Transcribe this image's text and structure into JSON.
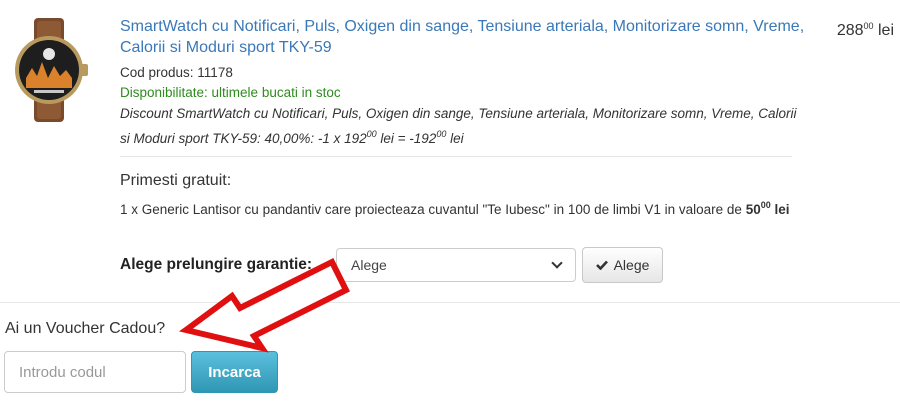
{
  "product": {
    "title": "SmartWatch cu Notificari, Puls, Oxigen din sange, Tensiune arteriala, Monitorizare somn, Vreme, Calorii si Moduri sport TKY-59",
    "price_int": "288",
    "price_dec": "00",
    "currency": "lei",
    "code": "Cod produs: 11178",
    "availability": "Disponibilitate: ultimele bucati in stoc",
    "discount_text": "Discount SmartWatch cu Notificari, Puls, Oxigen din sange, Tensiune arteriala, Monitorizare somn, Vreme, Calorii si Moduri sport TKY-59: 40,00%: -1 x 192",
    "discount_dec1": "00",
    "discount_mid": " lei = -192",
    "discount_dec2": "00",
    "discount_end": " lei"
  },
  "gift": {
    "heading": "Primesti gratuit:",
    "description": "1 x Generic Lantisor cu pandantiv care proiecteaza cuvantul \"Te Iubesc\" in 100 de limbi V1 in valoare de ",
    "value_int": "50",
    "value_dec": "00",
    "value_currency": "lei"
  },
  "warranty": {
    "label": "Alege prelungire garantie:",
    "select_value": "Alege",
    "button_label": "Alege"
  },
  "voucher": {
    "heading": "Ai un Voucher Cadou?",
    "placeholder": "Introdu codul",
    "button_label": "Incarca"
  },
  "colors": {
    "link": "#3a78b8",
    "availability": "#2e8b1e",
    "voucher_button": "#5bc0de",
    "annotation_arrow": "#e01010"
  },
  "icons": {
    "warranty_button": "check-icon",
    "select": "chevron-down-icon"
  }
}
